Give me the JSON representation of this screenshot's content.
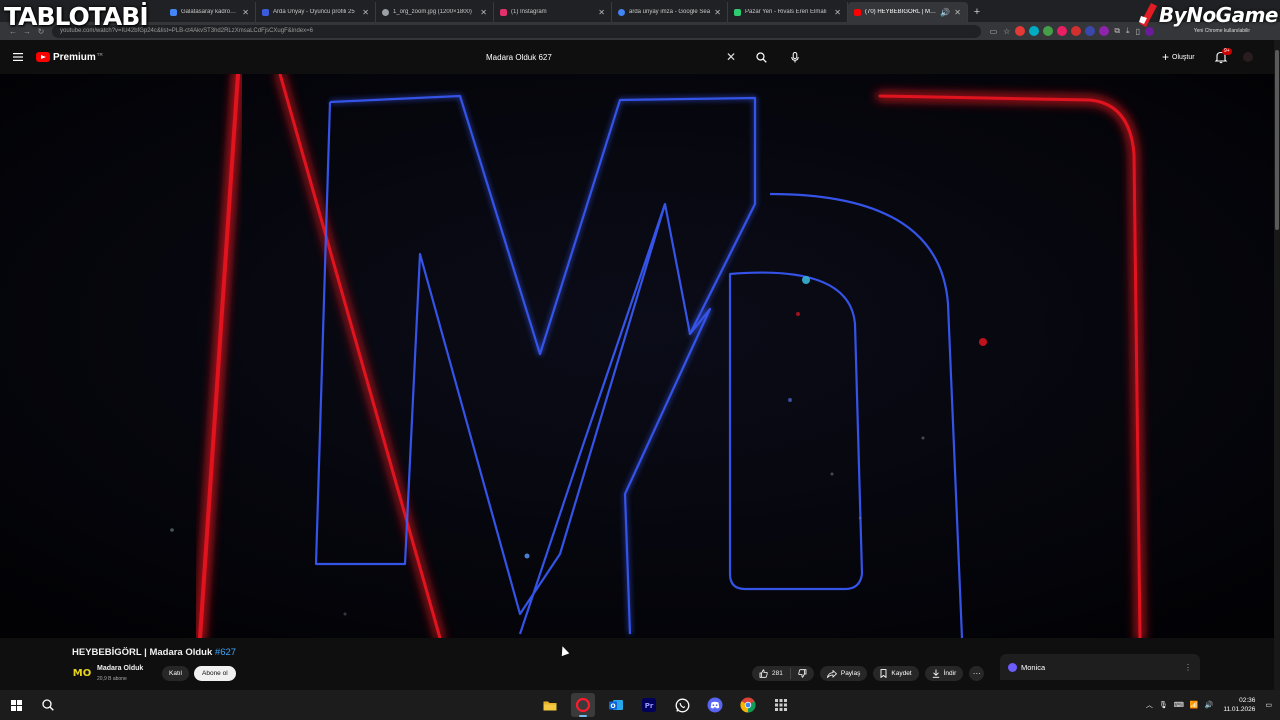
{
  "watermark": {
    "left": "TABLOTABİ",
    "right": "ByNoGame"
  },
  "browser": {
    "tabs": [
      {
        "label": "Galatasaray kadrosu - Google S",
        "color": "#4285f4",
        "active": false
      },
      {
        "label": "Arda Ünyay - Oyuncu profili 25",
        "color": "#3b5bdb",
        "active": false
      },
      {
        "label": "1_org_zoom.jpg (1200×1800)",
        "color": "#9aa0a6",
        "active": false
      },
      {
        "label": "(1) Instagram",
        "color": "#e1306c",
        "active": false
      },
      {
        "label": "arda ünyay imza - Google Sea",
        "color": "#4285f4",
        "active": false
      },
      {
        "label": "Pazar Yeri - Rivals Eren Elmalı",
        "color": "#2ecc71",
        "active": false
      },
      {
        "label": "(70) HEYBEBİGÖRL | Madar",
        "color": "#ff0000",
        "active": true
      }
    ],
    "url": "youtube.com/watch?v=IU42bfGp24c&list=PLB-ct4AkvST3hd2RLzXmsaLCdFjsCXugF&index=6",
    "profile_note": "Yeni Chrome kullanılabilir"
  },
  "youtube": {
    "brand": "Premium",
    "brand_sup": "TR",
    "search_query": "Madara Olduk 627",
    "create_label": "Oluştur",
    "notif_count": "9+"
  },
  "video": {
    "title": "HEYBEBİGÖRL | Madara Olduk ",
    "hashtag": "#627",
    "channel_avatar": "MO",
    "channel_name": "Madara Olduk",
    "channel_subs": "20,9 B abone",
    "join_label": "Katıl",
    "subscribe_label": "Abone ol",
    "likes": "281",
    "share_label": "Paylaş",
    "save_label": "Kaydet",
    "download_label": "İndir",
    "more_label": "···"
  },
  "sidepanel": {
    "name": "Monica",
    "menu": "⋮"
  },
  "taskbar": {
    "time": "02:36",
    "date": "11.01.2026",
    "apps": [
      {
        "name": "file-explorer",
        "glyph": "",
        "color": "#e8b32a"
      },
      {
        "name": "opera",
        "glyph": "O",
        "color": "#ff1b2d"
      },
      {
        "name": "outlook",
        "glyph": "O",
        "color": "#0a64d8"
      },
      {
        "name": "premiere",
        "glyph": "Pr",
        "color": "#9999ff"
      },
      {
        "name": "whatsapp",
        "glyph": "",
        "color": "#25d366"
      },
      {
        "name": "discord",
        "glyph": "",
        "color": "#5865f2"
      },
      {
        "name": "chrome",
        "glyph": "",
        "color": "#e33b2e"
      },
      {
        "name": "apps-grid",
        "glyph": "",
        "color": "#cccccc"
      }
    ]
  }
}
